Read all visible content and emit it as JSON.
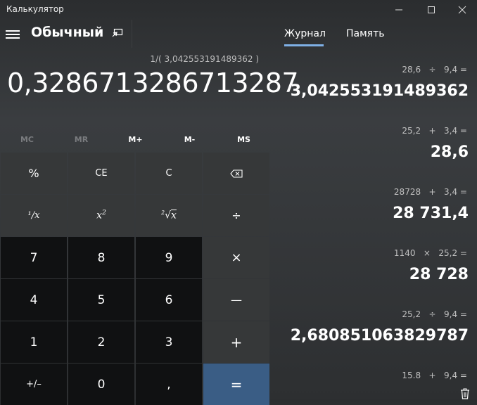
{
  "app": {
    "title": "Калькулятор"
  },
  "window": {
    "minimize": "–",
    "maximize": "☐",
    "close": "✕"
  },
  "header": {
    "mode": "Обычный"
  },
  "display": {
    "expression": "1/( 3,042553191489362 )",
    "value": "0,3286713286713287"
  },
  "memory": [
    "MC",
    "MR",
    "M+",
    "M-",
    "MS"
  ],
  "keys": {
    "percent": "%",
    "ce": "CE",
    "c": "C",
    "reciprocal_num": "¹",
    "reciprocal_x": "x",
    "square_x": "x",
    "square_pow": "2",
    "sqrt_idx": "2",
    "sqrt_x": "x",
    "divide": "÷",
    "multiply": "×",
    "minus": "—",
    "plus": "+",
    "equals": "=",
    "d7": "7",
    "d8": "8",
    "d9": "9",
    "d4": "4",
    "d5": "5",
    "d6": "6",
    "d1": "1",
    "d2": "2",
    "d3": "3",
    "negate": "+/–",
    "d0": "0",
    "decimal": ","
  },
  "tabs": {
    "history": "Журнал",
    "memory": "Память"
  },
  "history": [
    {
      "expr": "28,6   ÷   9,4 =",
      "result": "3,042553191489362"
    },
    {
      "expr": "25,2   +   3,4 =",
      "result": "28,6"
    },
    {
      "expr": "28728   +   3,4 =",
      "result": "28 731,4"
    },
    {
      "expr": "1140   ×   25,2 =",
      "result": "28 728"
    },
    {
      "expr": "25,2   ÷   9,4 =",
      "result": "2,680851063829787"
    },
    {
      "expr": "15.8   +   9,4 =",
      "result": ""
    }
  ]
}
